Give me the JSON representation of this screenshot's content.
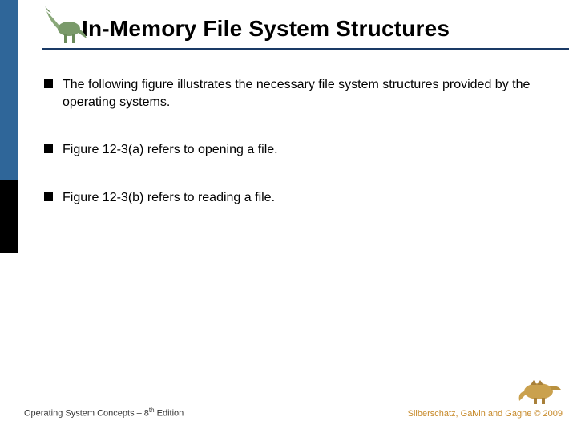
{
  "title": "In-Memory File System Structures",
  "bullets": [
    "The following figure illustrates the necessary file system structures provided by the operating systems.",
    "Figure 12-3(a) refers to opening a file.",
    "Figure 12-3(b) refers to reading a file."
  ],
  "footer": {
    "left_prefix": "Operating System Concepts – 8",
    "left_suffix": " Edition",
    "ordinal": "th",
    "right": "Silberschatz, Galvin and Gagne © 2009"
  },
  "icons": {
    "top_left": "dinosaur-icon",
    "bottom_right": "dinosaur-icon"
  }
}
